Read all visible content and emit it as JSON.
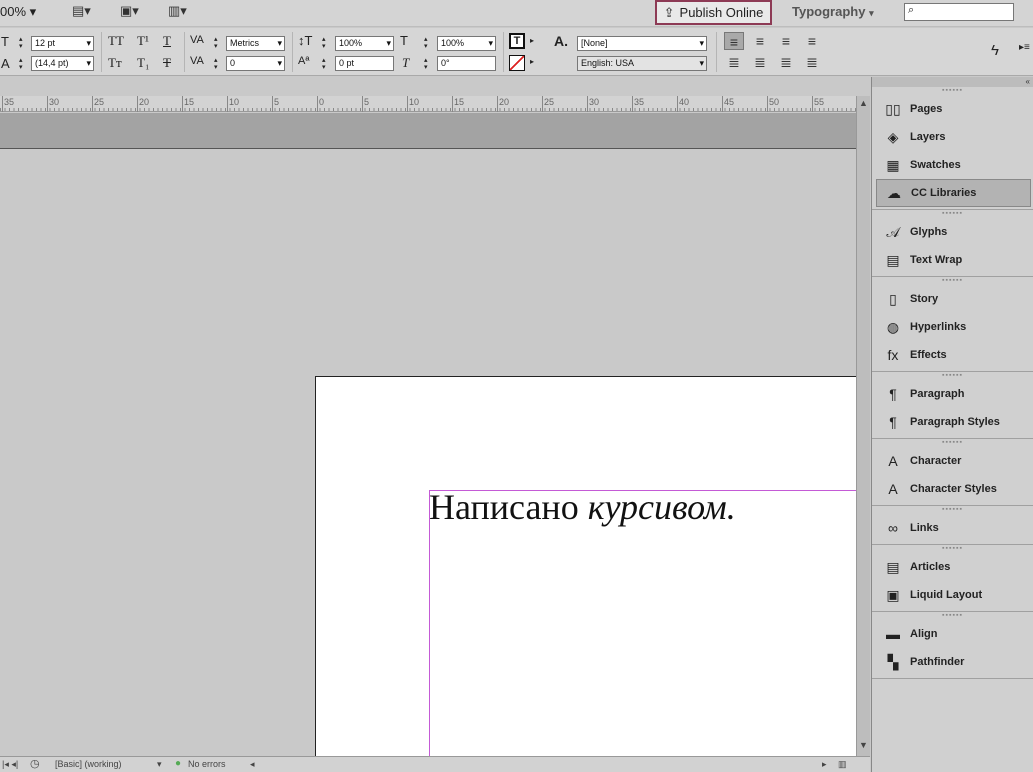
{
  "app": {
    "zoom": "00%",
    "publish_label": "Publish Online",
    "workspace": "Typography",
    "search_placeholder": ""
  },
  "control": {
    "font_size": "12 pt",
    "leading": "(14,4 pt)",
    "kerning": "Metrics",
    "tracking": "0",
    "vscale": "100%",
    "hscale": "100%",
    "baseline": "0 pt",
    "skew": "0°",
    "char_style": "[None]",
    "language": "English: USA"
  },
  "ruler": [
    "35",
    "30",
    "25",
    "20",
    "15",
    "10",
    "5",
    "0",
    "5",
    "10",
    "15",
    "20",
    "25",
    "30",
    "35",
    "40",
    "45",
    "50",
    "55"
  ],
  "document": {
    "text_plain": "Написано ",
    "text_italic": "курсивом."
  },
  "status": {
    "preflight_profile": "[Basic] (working)",
    "errors": "No errors"
  },
  "panels": {
    "groups": [
      [
        {
          "label": "Pages",
          "icon": "▯▯"
        },
        {
          "label": "Layers",
          "icon": "◈"
        },
        {
          "label": "Swatches",
          "icon": "▦"
        },
        {
          "label": "CC Libraries",
          "icon": "☁"
        }
      ],
      [
        {
          "label": "Glyphs",
          "icon": "𝒜"
        },
        {
          "label": "Text Wrap",
          "icon": "▤"
        }
      ],
      [
        {
          "label": "Story",
          "icon": "▯"
        },
        {
          "label": "Hyperlinks",
          "icon": "◍"
        },
        {
          "label": "Effects",
          "icon": "fx"
        }
      ],
      [
        {
          "label": "Paragraph",
          "icon": "¶"
        },
        {
          "label": "Paragraph Styles",
          "icon": "¶"
        }
      ],
      [
        {
          "label": "Character",
          "icon": "A"
        },
        {
          "label": "Character Styles",
          "icon": "A"
        }
      ],
      [
        {
          "label": "Links",
          "icon": "∞"
        }
      ],
      [
        {
          "label": "Articles",
          "icon": "▤"
        },
        {
          "label": "Liquid Layout",
          "icon": "▣"
        }
      ],
      [
        {
          "label": "Align",
          "icon": "▬"
        },
        {
          "label": "Pathfinder",
          "icon": "▚"
        }
      ]
    ]
  }
}
